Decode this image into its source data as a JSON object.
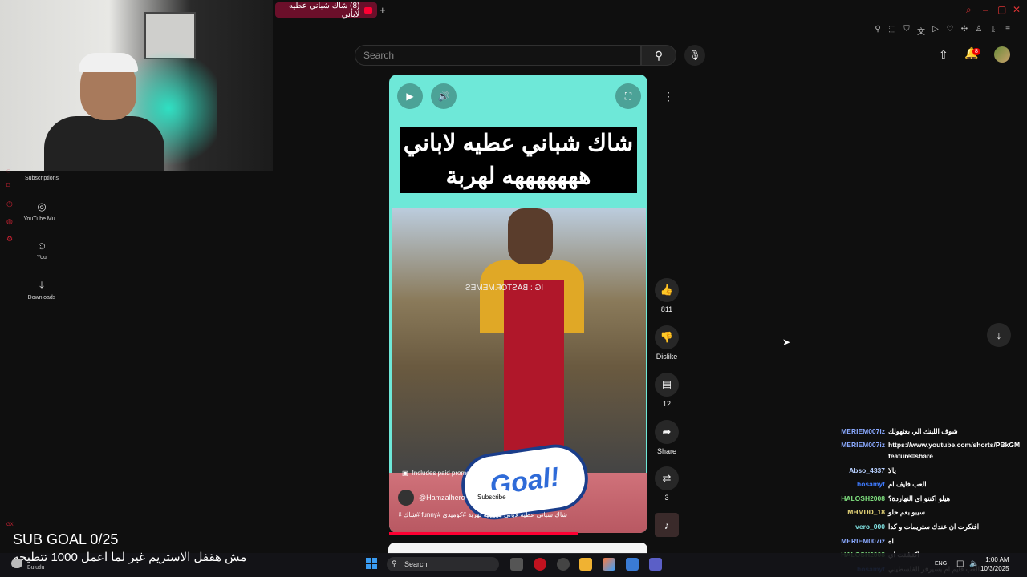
{
  "browser": {
    "tab_title": "(8) شاك شباني عطيه لاباني",
    "new_tab": "+",
    "toolbar_icons": [
      "pin-icon",
      "crop-icon",
      "shield-icon",
      "translate-icon",
      "play-icon",
      "heart-icon",
      "extensions-icon",
      "profile-icon",
      "download-icon",
      "menu-icon"
    ]
  },
  "masthead": {
    "search_placeholder": "Search",
    "notifications": "8"
  },
  "sidebar": {
    "items": [
      {
        "label": "Subscriptions",
        "icon": "subscriptions-icon"
      },
      {
        "label": "YouTube Mu...",
        "icon": "music-icon"
      },
      {
        "label": "You",
        "icon": "user-icon"
      },
      {
        "label": "Downloads",
        "icon": "download-icon"
      }
    ]
  },
  "short": {
    "banner_line1": "شاك شباني عطيه لاباني",
    "banner_line2": "هههههههه لهربة",
    "watermark": "IG : BASTOF.MEMES",
    "paid_promotion": "Includes paid promotion",
    "channel": "@Hamzalhero",
    "subscribe": "Subscribe",
    "title": "شاك شباني عطيه لاباني هههههه لهربة #كوميدي #funny #شاك #بوسعيد",
    "goal_sticker": "Goal!",
    "progress": 0.73
  },
  "actions": {
    "likes": "811",
    "dislike": "Dislike",
    "comments": "12",
    "share": "Share",
    "remix": "3"
  },
  "chat": [
    {
      "user": "MERIEM007iz",
      "msg": "شوف اللينك الي بعثهولك",
      "color": "#8aa9ff"
    },
    {
      "user": "MERIEM007iz",
      "msg": "https://www.youtube.com/shorts/PBkGM",
      "color": "#8aa9ff"
    },
    {
      "user": "",
      "msg": "feature=share",
      "color": "#8aa9ff"
    },
    {
      "user": "Abso_4337",
      "msg": "يالا",
      "color": "#b8d0ff"
    },
    {
      "user": "hosamyt",
      "msg": "العب فايف ام",
      "color": "#3f7bff"
    },
    {
      "user": "HALOSH2008",
      "msg": "هيلو اكنتو اي النهاردة؟",
      "color": "#7fe07f"
    },
    {
      "user": "MHMDD_18",
      "msg": "سيبو بعم حلو",
      "color": "#e8d77a"
    },
    {
      "user": "vero_000",
      "msg": "افتكرت ان عندك ستريمات و كدا",
      "color": "#7fe0e0"
    },
    {
      "user": "MERIEM007iz",
      "msg": "اه",
      "color": "#8aa9ff"
    },
    {
      "user": "HALOSH2008",
      "msg": "اكتشتت اي",
      "color": "#7fe07f"
    },
    {
      "user": "hosamyt",
      "msg": "العب قايم ام بسيرفر الفلسطيني",
      "color": "#3f7bff"
    }
  ],
  "overlay": {
    "sub_goal": "SUB GOAL 0/25",
    "banner": "مش هقفل الاستريم غير لما اعمل 1000 تتطيحه",
    "weather": "Bulutlu",
    "gx": "GX"
  },
  "taskbar": {
    "search": "Search",
    "lang": "ENG",
    "time": "1:00 AM",
    "date": "10/3/2025"
  }
}
